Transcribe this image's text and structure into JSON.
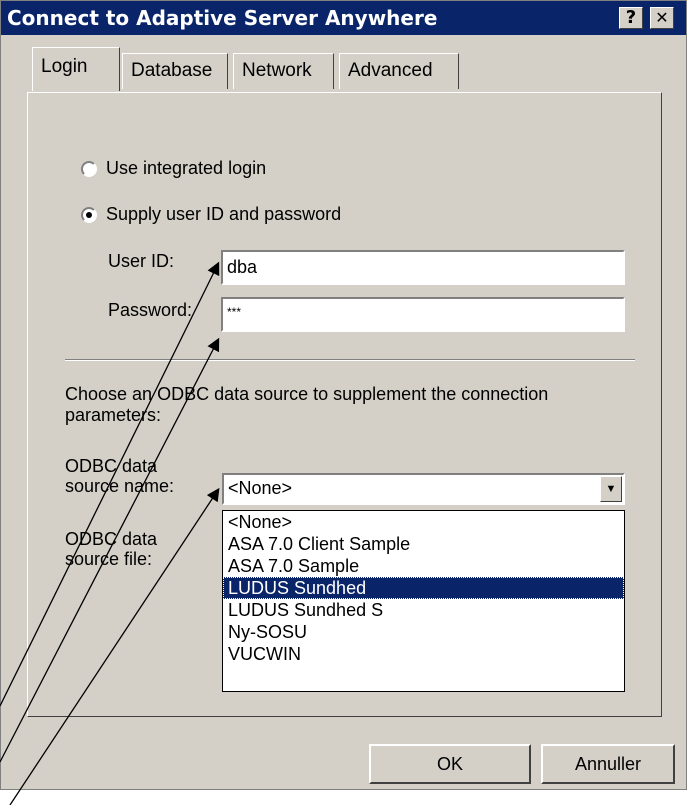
{
  "window": {
    "title": "Connect to Adaptive Server Anywhere",
    "help_label": "?",
    "close_label": "✕"
  },
  "tabs": [
    {
      "label": "Login",
      "active": true
    },
    {
      "label": "Database",
      "active": false
    },
    {
      "label": "Network",
      "active": false
    },
    {
      "label": "Advanced",
      "active": false
    }
  ],
  "login": {
    "radio_integrated": "Use integrated login",
    "radio_supply": "Supply user ID and password",
    "selected_radio": "supply",
    "user_id_label": "User ID:",
    "user_id_value": "dba",
    "password_label": "Password:",
    "password_value": "***",
    "odbc_intro": "Choose an ODBC data source to supplement the connection parameters:",
    "odbc_name_label": "ODBC data source name:",
    "odbc_name_value": "<None>",
    "odbc_file_label": "ODBC data source file:",
    "dropdown_options": [
      "<None>",
      "ASA 7.0 Client Sample",
      "ASA 7.0 Sample",
      "LUDUS Sundhed",
      "LUDUS Sundhed S",
      "Ny-SOSU",
      "VUCWIN"
    ],
    "dropdown_selected": "LUDUS Sundhed"
  },
  "buttons": {
    "ok": "OK",
    "cancel": "Annuller"
  },
  "colors": {
    "titlebar": "#0a246a",
    "face": "#d4d0c8",
    "highlight": "#0a246a"
  }
}
